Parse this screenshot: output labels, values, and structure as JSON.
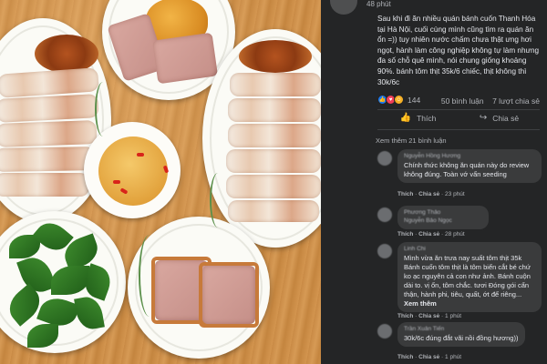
{
  "post": {
    "time": "48 phút",
    "text": "Sau khi đi ăn nhiều quán bánh cuốn Thanh Hóa tại Hà Nội, cuối cùng mình cũng tìm ra quán ăn ổn =)) tuy nhiên nước chấm chưa thật ưng hơi ngọt, hành làm công nghiệp không tự làm nhưng đa số chỗ quê mình, nói chung giống khoảng 90%. bánh tôm thịt 35k/6 chiếc, thịt không thì 30k/6c"
  },
  "reactions": {
    "count": "144",
    "icons": [
      "like-icon",
      "heart-icon",
      "haha-icon"
    ]
  },
  "stats": {
    "comments": "50 bình luận",
    "shares": "7 lượt chia sẻ"
  },
  "actions": {
    "like_label": "Thích",
    "share_label": "Chia sẻ"
  },
  "more_comments": "Xem thêm 21 bình luận",
  "comments": [
    {
      "name": "Nguyễn Hồng Hương",
      "text": "Chính thức không ăn quán này do review không đúng. Toàn vớ vẩn seeding",
      "like": "Thích",
      "reply": "Chia sẻ",
      "time": "23 phút"
    },
    {
      "name": "Phương Thảo",
      "name2": "Nguyễn Bảo Ngọc",
      "like": "Thích",
      "reply": "Chia sẻ",
      "time": "28 phút"
    },
    {
      "name": "Linh Chi",
      "text": "Mình vừa ăn trưa nay suất tôm thịt 35k Bánh cuốn tôm thịt là tôm biển cắt bé chứ ko ạc nguyên cả con như ảnh. Bánh cuộn dài to. vị ổn, tôm chắc. tươi Đóng gói cẩn thận, hành phi, tiêu, quất, ớt để riêng...",
      "see_more": "Xem thêm",
      "like": "Thích",
      "reply": "Chia sẻ",
      "time": "1 phút"
    },
    {
      "name": "Trần Xuân Tiến",
      "text": "30k/6c đúng đắt vãi nồi đồng hương))",
      "like": "Thích",
      "reply": "Chia sẻ",
      "time": "1 phút"
    }
  ]
}
